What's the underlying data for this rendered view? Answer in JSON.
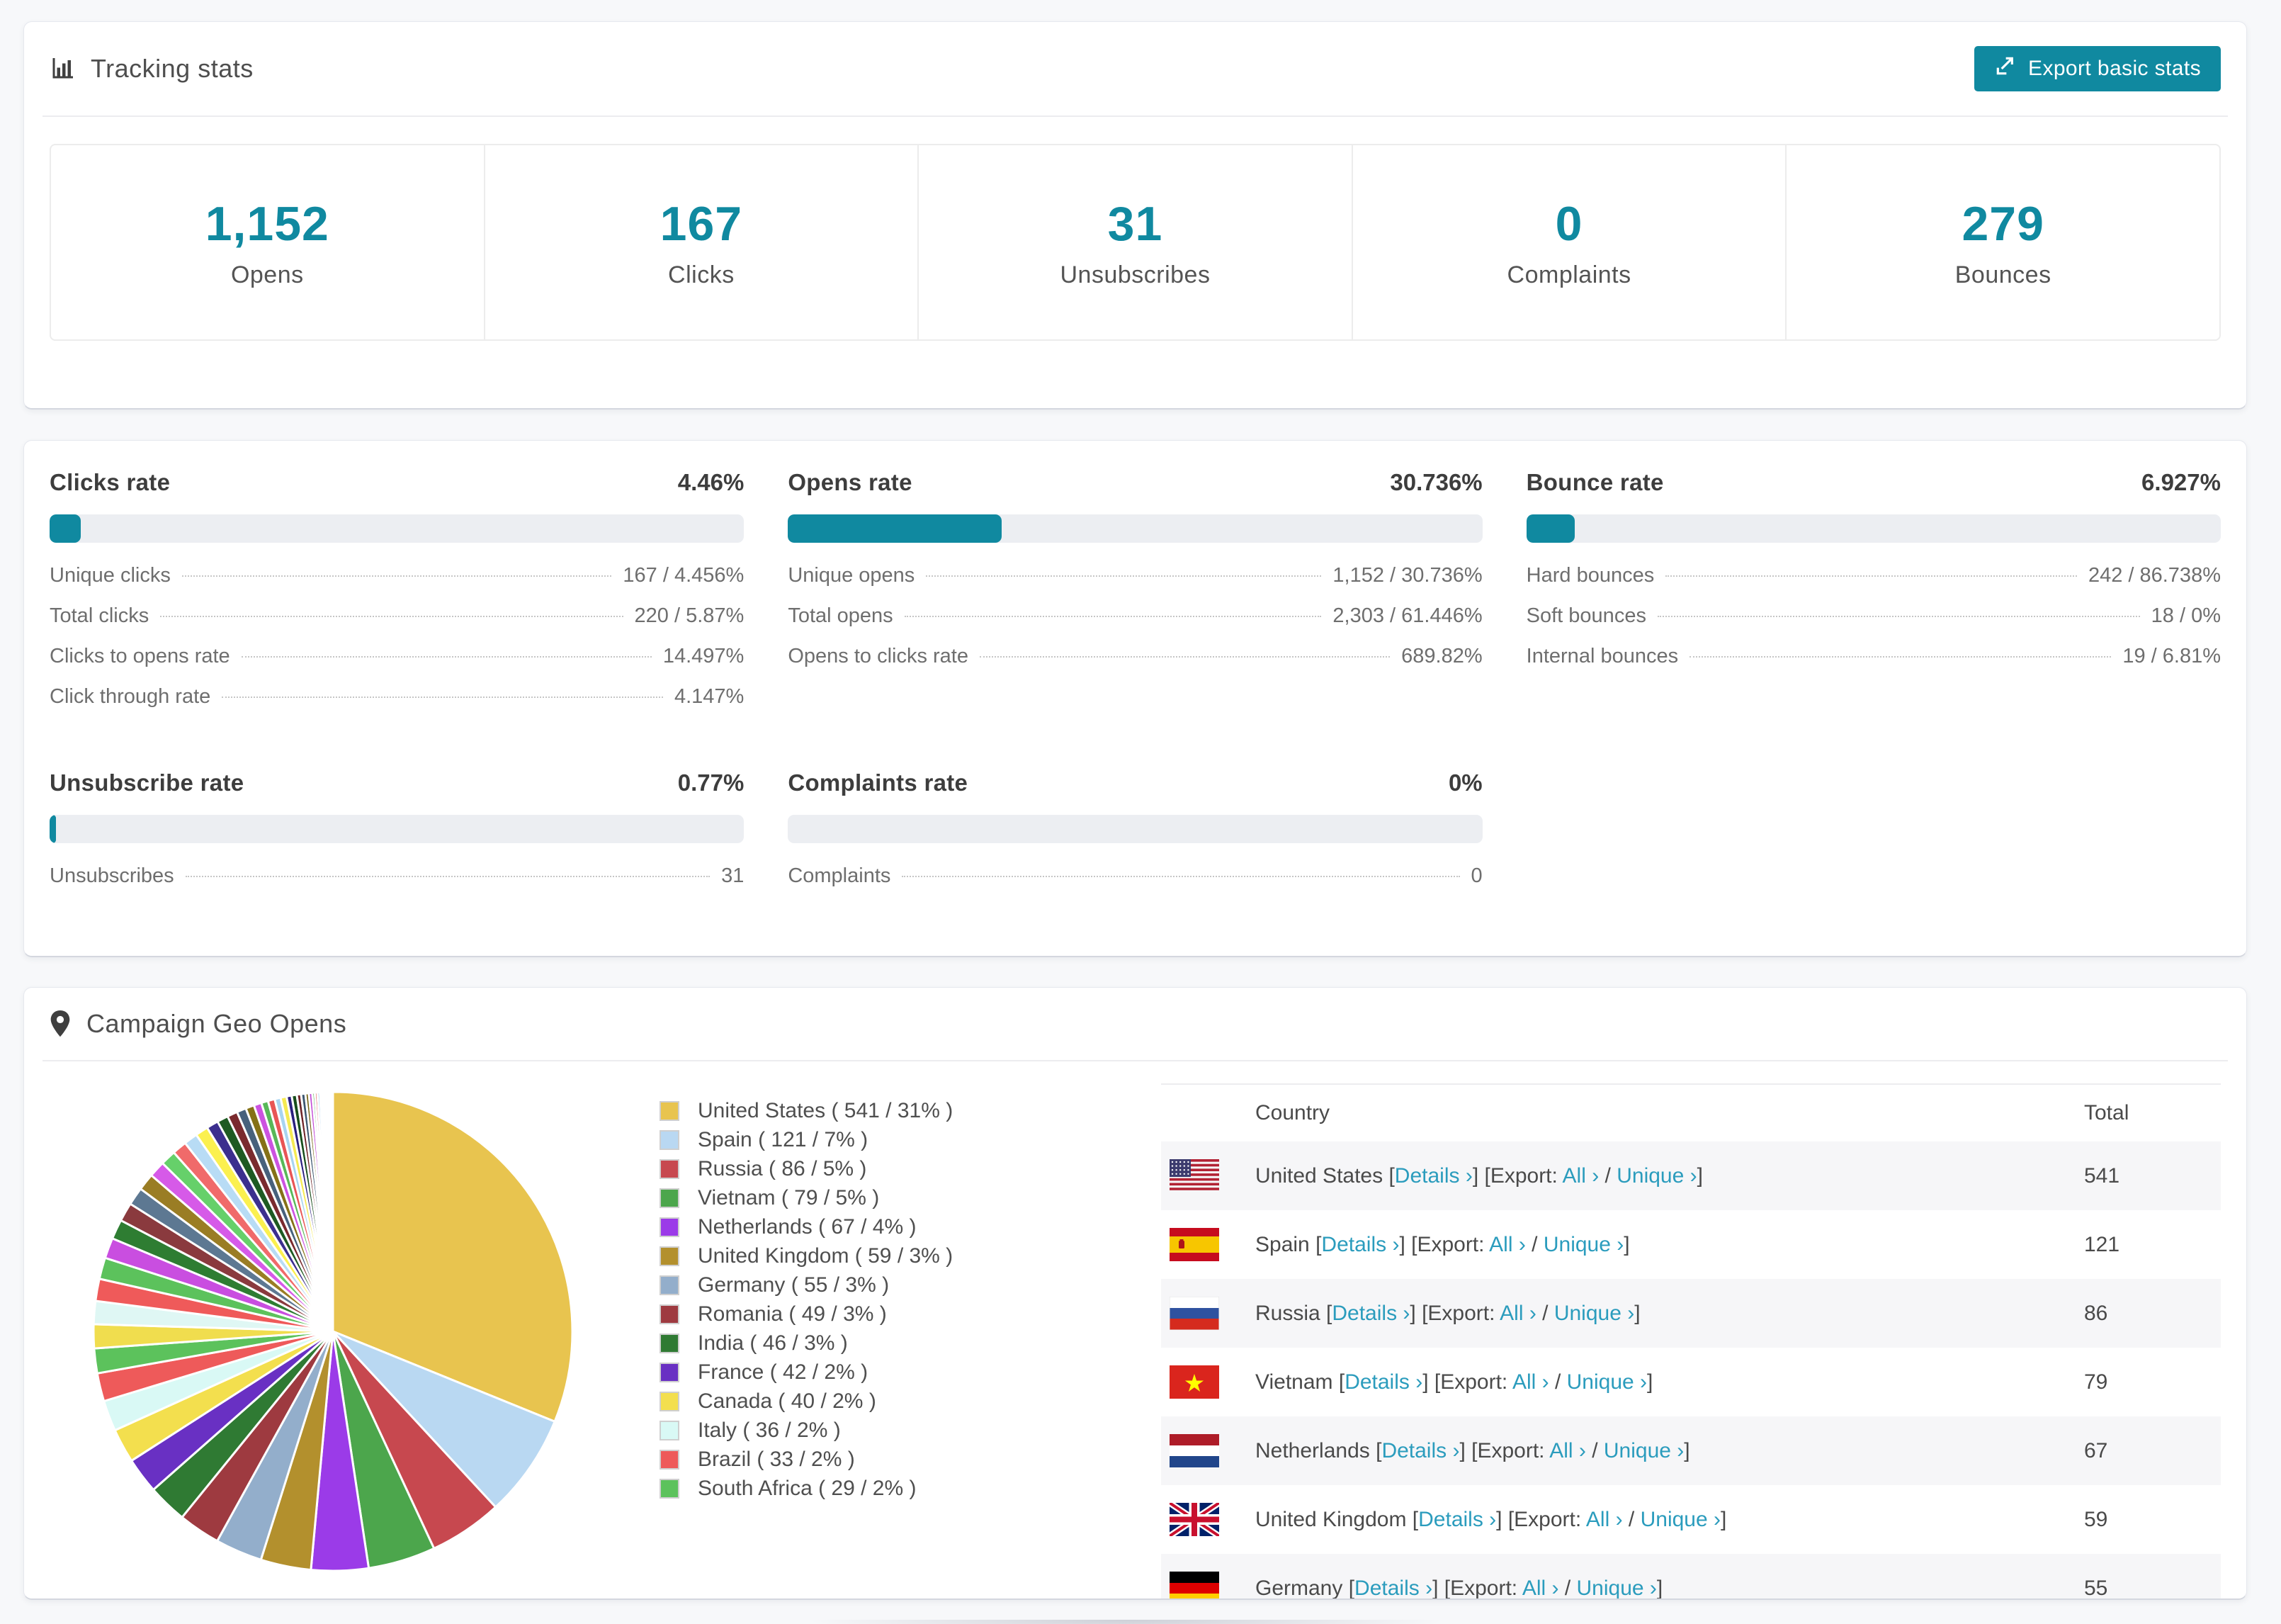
{
  "accent": {
    "teal": "#1089a0",
    "link": "#2b9cbd"
  },
  "tracking": {
    "title": "Tracking stats",
    "export_button": "Export basic stats",
    "stats": [
      {
        "value": "1,152",
        "label": "Opens"
      },
      {
        "value": "167",
        "label": "Clicks"
      },
      {
        "value": "31",
        "label": "Unsubscribes"
      },
      {
        "value": "0",
        "label": "Complaints"
      },
      {
        "value": "279",
        "label": "Bounces"
      }
    ]
  },
  "rates": [
    {
      "title": "Clicks rate",
      "value": "4.46%",
      "bar_pct": 4.46,
      "rows": [
        {
          "label": "Unique clicks",
          "value": "167 / 4.456%"
        },
        {
          "label": "Total clicks",
          "value": "220 / 5.87%"
        },
        {
          "label": "Clicks to opens rate",
          "value": "14.497%"
        },
        {
          "label": "Click through rate",
          "value": "4.147%"
        }
      ]
    },
    {
      "title": "Opens rate",
      "value": "30.736%",
      "bar_pct": 30.736,
      "rows": [
        {
          "label": "Unique opens",
          "value": "1,152 / 30.736%"
        },
        {
          "label": "Total opens",
          "value": "2,303 / 61.446%"
        },
        {
          "label": "Opens to clicks rate",
          "value": "689.82%"
        }
      ]
    },
    {
      "title": "Bounce rate",
      "value": "6.927%",
      "bar_pct": 6.927,
      "rows": [
        {
          "label": "Hard bounces",
          "value": "242 / 86.738%"
        },
        {
          "label": "Soft bounces",
          "value": "18 / 0%"
        },
        {
          "label": "Internal bounces",
          "value": "19 / 6.81%"
        }
      ]
    },
    {
      "title": "Unsubscribe rate",
      "value": "0.77%",
      "bar_pct": 0.77,
      "rows": [
        {
          "label": "Unsubscribes",
          "value": "31"
        }
      ]
    },
    {
      "title": "Complaints rate",
      "value": "0%",
      "bar_pct": 0,
      "rows": [
        {
          "label": "Complaints",
          "value": "0"
        }
      ]
    }
  ],
  "geo": {
    "title": "Campaign Geo Opens",
    "chart_data": {
      "type": "pie",
      "legend_position": "right",
      "legend_format": "name ( value / pct )",
      "series": [
        {
          "name": "United States",
          "value": 541,
          "pct": "31%",
          "color": "#e8c44f",
          "flag": "us"
        },
        {
          "name": "Spain",
          "value": 121,
          "pct": "7%",
          "color": "#b9d8f2",
          "flag": "es"
        },
        {
          "name": "Russia",
          "value": 86,
          "pct": "5%",
          "color": "#c7484f",
          "flag": "ru"
        },
        {
          "name": "Vietnam",
          "value": 79,
          "pct": "5%",
          "color": "#4ca64c",
          "flag": "vn"
        },
        {
          "name": "Netherlands",
          "value": 67,
          "pct": "4%",
          "color": "#9b3be8",
          "flag": "nl"
        },
        {
          "name": "United Kingdom",
          "value": 59,
          "pct": "3%",
          "color": "#b3902d",
          "flag": "gb"
        },
        {
          "name": "Germany",
          "value": 55,
          "pct": "3%",
          "color": "#93aecb",
          "flag": "de"
        },
        {
          "name": "Romania",
          "value": 49,
          "pct": "3%",
          "color": "#9e3a40",
          "flag": "ro"
        },
        {
          "name": "India",
          "value": 46,
          "pct": "3%",
          "color": "#2f7a33",
          "flag": "in"
        },
        {
          "name": "France",
          "value": 42,
          "pct": "2%",
          "color": "#6930c3",
          "flag": "fr"
        },
        {
          "name": "Canada",
          "value": 40,
          "pct": "2%",
          "color": "#f3df4e",
          "flag": "ca"
        },
        {
          "name": "Italy",
          "value": 36,
          "pct": "2%",
          "color": "#d9f9f5",
          "flag": "it"
        },
        {
          "name": "Brazil",
          "value": 33,
          "pct": "2%",
          "color": "#ee5a5a",
          "flag": "br"
        },
        {
          "name": "South Africa",
          "value": 29,
          "pct": "2%",
          "color": "#5cc25c",
          "flag": "za"
        }
      ],
      "others_estimated": {
        "values": [
          28,
          27,
          26,
          25,
          24,
          23,
          22,
          21,
          20,
          19,
          18,
          17,
          16,
          15,
          14,
          13,
          12,
          11,
          10,
          9,
          8,
          8,
          7,
          7,
          6,
          6,
          5,
          5,
          4,
          4,
          3,
          3,
          3,
          2,
          2,
          2,
          2,
          1,
          1,
          1,
          1,
          1,
          1,
          1
        ],
        "colors": [
          "#f0dd4e",
          "#dff7f4",
          "#ef5a5a",
          "#5cc25c",
          "#c94ee0",
          "#2e7d32",
          "#8a3a3e",
          "#5d7892",
          "#9a7d24",
          "#d65ae8",
          "#66d06a",
          "#f06a6a",
          "#b8dcf5",
          "#fbf04f",
          "#3c2f8e",
          "#1e5a22",
          "#7a2a2e",
          "#47617c",
          "#857117",
          "#cc53e0",
          "#58b858",
          "#e85555",
          "#a8d4f0",
          "#f5ea52",
          "#2a1f7e",
          "#174d1b",
          "#6e2428",
          "#3d5770",
          "#756414",
          "#c149d6",
          "#4daf4d",
          "#e04a4a",
          "#98c8ec",
          "#efe44e"
        ]
      }
    },
    "table": {
      "headers": [
        "Country",
        "Total"
      ],
      "link_format": {
        "open": "[",
        "close": "]",
        "details": "Details ›",
        "export_prefix": "[Export:",
        "all": "All ›",
        "slash": "/",
        "unique": "Unique ›"
      },
      "rows": [
        {
          "country": "United States",
          "flag": "us",
          "total": "541"
        },
        {
          "country": "Spain",
          "flag": "es",
          "total": "121"
        },
        {
          "country": "Russia",
          "flag": "ru",
          "total": "86"
        },
        {
          "country": "Vietnam",
          "flag": "vn",
          "total": "79"
        },
        {
          "country": "Netherlands",
          "flag": "nl",
          "total": "67"
        },
        {
          "country": "United Kingdom",
          "flag": "gb",
          "total": "59"
        },
        {
          "country": "Germany",
          "flag": "de",
          "total": "55"
        }
      ]
    }
  }
}
